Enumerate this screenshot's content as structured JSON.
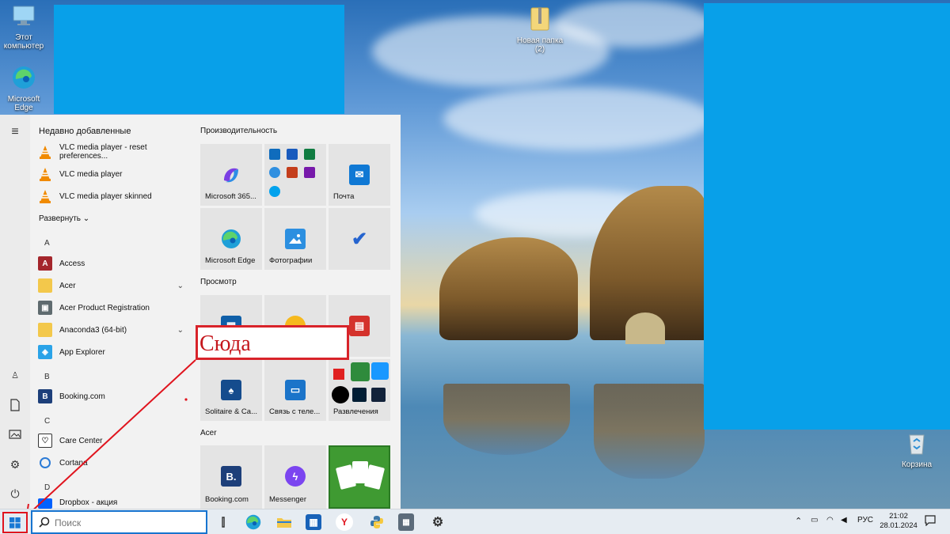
{
  "desktop": {
    "icons": [
      {
        "label": "Этот компьютер"
      },
      {
        "label": "Microsoft Edge"
      },
      {
        "label": "Новая папка (2)"
      },
      {
        "label": "Корзина"
      }
    ]
  },
  "start_menu": {
    "recent_header": "Недавно добавленные",
    "recent": [
      {
        "label": "VLC media player - reset preferences...",
        "icon": "vlc-icon"
      },
      {
        "label": "VLC media player",
        "icon": "vlc-icon"
      },
      {
        "label": "VLC media player skinned",
        "icon": "vlc-icon"
      }
    ],
    "expand_label": "Развернуть",
    "letters": [
      "A",
      "B",
      "C",
      "D"
    ],
    "apps": [
      {
        "label": "Access",
        "icon": "access-icon"
      },
      {
        "label": "Acer",
        "icon": "folder-icon"
      },
      {
        "label": "Acer Product Registration",
        "icon": "acer-registration-icon"
      },
      {
        "label": "Anaconda3 (64-bit)",
        "icon": "folder-icon"
      },
      {
        "label": "App Explorer",
        "icon": "app-explorer-icon"
      },
      {
        "label": "Booking.com",
        "icon": "booking-icon"
      },
      {
        "label": "Care Center",
        "icon": "care-center-icon"
      },
      {
        "label": "Cortana",
        "icon": "cortana-icon"
      },
      {
        "label": "Dropbox - акция",
        "icon": "dropbox-icon"
      }
    ],
    "groups": [
      "Производительность",
      "Просмотр",
      "Acer"
    ],
    "tiles": {
      "productivity": [
        {
          "label": "Microsoft 365...",
          "icon": "microsoft-365-icon"
        },
        {
          "label": "",
          "icon": "office-apps-icon"
        },
        {
          "label": "Почта",
          "icon": "mail-icon"
        },
        {
          "label": "Microsoft Edge",
          "icon": "edge-icon"
        },
        {
          "label": "Фотографии",
          "icon": "photos-icon"
        },
        {
          "label": "",
          "icon": "todo-icon"
        }
      ],
      "browse": [
        {
          "label": "",
          "icon": "store-icon"
        },
        {
          "label": "",
          "icon": "weather-icon"
        },
        {
          "label": "",
          "icon": "news-icon"
        },
        {
          "label": "Solitaire & Ca...",
          "icon": "solitaire-icon"
        },
        {
          "label": "Связь с теле...",
          "icon": "phone-link-icon"
        },
        {
          "label": "Развлечения",
          "icon": "entertainment-icon"
        }
      ],
      "acer": [
        {
          "label": "Booking.com",
          "icon": "booking-icon"
        },
        {
          "label": "Messenger",
          "icon": "messenger-icon"
        },
        {
          "label": "",
          "icon": "solitaire-game-icon"
        }
      ]
    }
  },
  "annotation": {
    "text": "Сюда"
  },
  "taskbar": {
    "search_placeholder": "Поиск",
    "language": "РУС",
    "time": "21:02",
    "date": "28.01.2024"
  },
  "colors": {
    "start_highlight": "#e0141e",
    "search_border": "#1774cf",
    "annotation": "#d8232a",
    "blue_blocks": "#08a0e9"
  }
}
